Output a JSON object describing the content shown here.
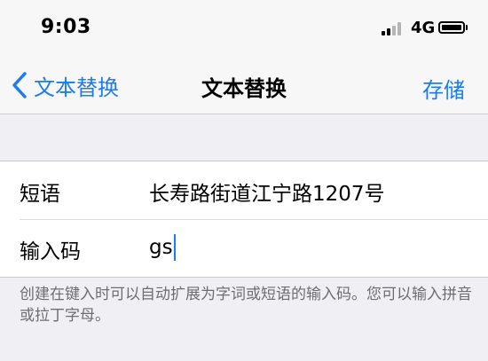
{
  "status_bar": {
    "time": "9:03",
    "network": "4G",
    "icons": [
      "signal-icon",
      "battery-icon"
    ]
  },
  "nav": {
    "back_label": "文本替换",
    "title": "文本替换",
    "save_label": "存储",
    "accent_color": "#1a7cf5"
  },
  "form": {
    "phrase_label": "短语",
    "phrase_value": "长寿路街道江宁路1207号",
    "shortcut_label": "输入码",
    "shortcut_value": "gs"
  },
  "footnote": "创建在键入时可以自动扩展为字词或短语的输入码。您可以输入拼音或拉丁字母。"
}
